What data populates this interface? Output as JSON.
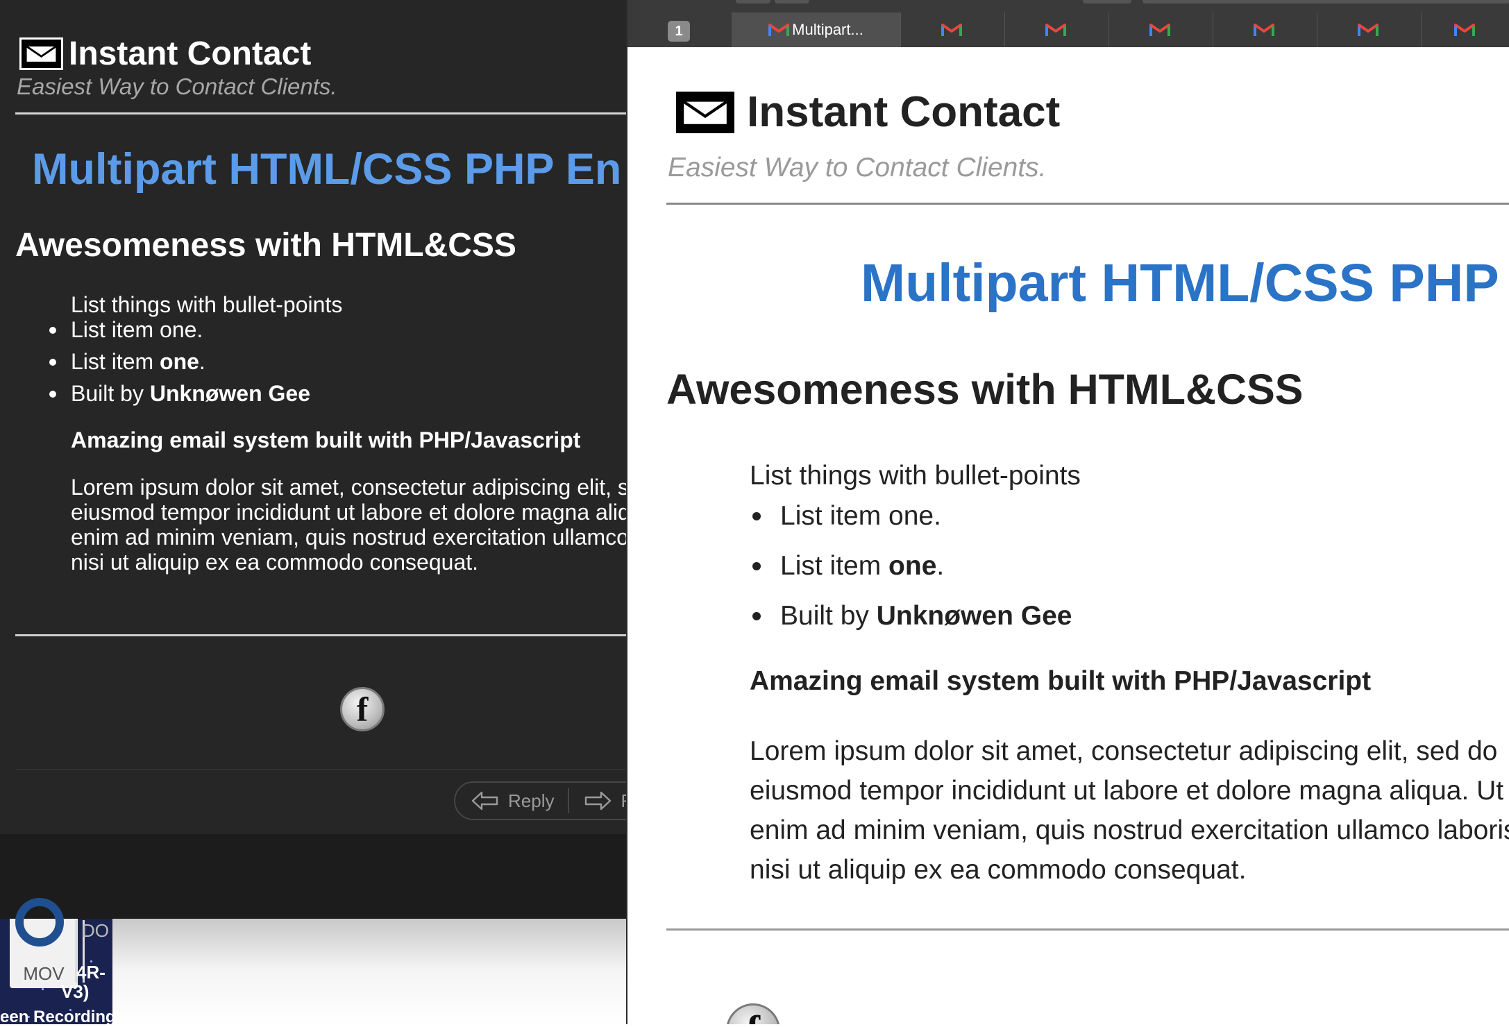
{
  "email": {
    "brand_title": "Instant Contact",
    "tagline": "Easiest Way to Contact Clients.",
    "heading": "Multipart HTML/CSS PHP Email",
    "heading_left_visible": "Multipart HTML/CSS PHP En",
    "heading_right_visible": "Multipart HTML/CSS PHP",
    "subheading": "Awesomeness with HTML&CSS",
    "list_intro": "List things with bullet-points",
    "list": [
      {
        "text": "List item one.",
        "bold": "",
        "suffix": ""
      },
      {
        "text": "List item ",
        "bold": "one",
        "suffix": "."
      },
      {
        "text": "Built by ",
        "bold": "Unknøwen Gee",
        "suffix": ""
      }
    ],
    "section_title": "Amazing email system built with PHP/Javascript",
    "lorem_left": "Lorem ipsum dolor sit amet, consectetur adipiscing elit, sed do eiusmod tempor incididunt ut labore et dolore magna aliqua. Ut enim ad minim veniam, quis nostrud exercitation ullamco laboris nisi ut aliquip ex ea commodo consequat.",
    "lorem_right": "Lorem ipsum dolor sit amet, consectetur adipiscing elit, sed do eiusmod tempor incididunt ut labore et dolore magna aliqua. Ut enim ad minim veniam, quis nostrud exercitation ullamco laboris nisi ut aliquip ex ea commodo consequat.",
    "facebook_glyph": "f"
  },
  "mail_actions": {
    "reply_label": "Reply",
    "forward_label": "F"
  },
  "browser": {
    "tab_group_badge": "1",
    "active_tab_title": "Multipart...",
    "tab_icon": "gmail-icon",
    "tab_count": 7
  },
  "desktop": {
    "file_type_label": "MOV",
    "file_label_1": "DO",
    "file_label_2": "4R-",
    "file_label_3": "V3)",
    "file_label_4": "een Recording"
  },
  "colors": {
    "link_blue_dark": "#5b9bea",
    "link_blue_light": "#2a73c7",
    "dark_bg": "#262626"
  }
}
